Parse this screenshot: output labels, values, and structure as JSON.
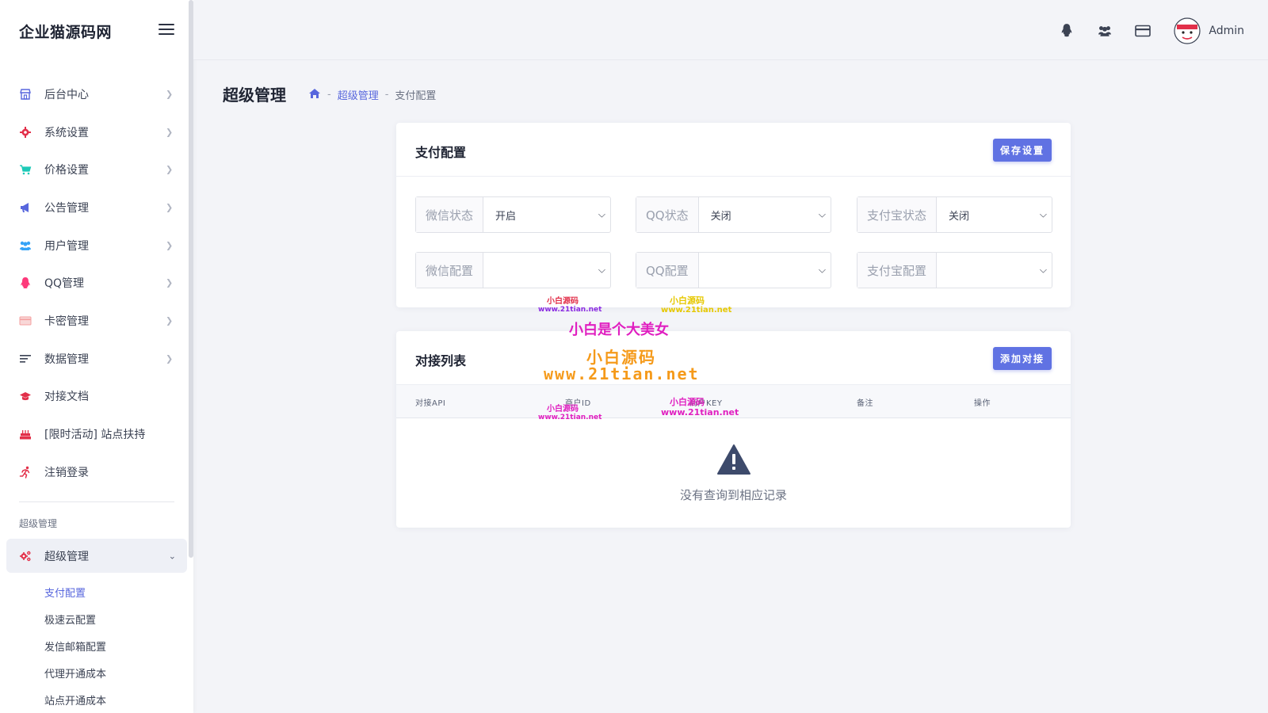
{
  "brand": {
    "name": "企业猫源码网"
  },
  "nav": [
    {
      "label": "后台中心",
      "icon": "store-icon",
      "color": "#5867dd"
    },
    {
      "label": "系统设置",
      "icon": "gear-icon",
      "color": "#e2304a"
    },
    {
      "label": "价格设置",
      "icon": "cart-icon",
      "color": "#1dc9b7"
    },
    {
      "label": "公告管理",
      "icon": "megaphone-icon",
      "color": "#5867dd"
    },
    {
      "label": "用户管理",
      "icon": "users-icon",
      "color": "#36a3f7"
    },
    {
      "label": "QQ管理",
      "icon": "qq-icon",
      "color": "#fd397a"
    },
    {
      "label": "卡密管理",
      "icon": "card-icon",
      "color": "#f5a0a0"
    },
    {
      "label": "数据管理",
      "icon": "bars-icon",
      "color": "#3b4253"
    },
    {
      "label": "对接文档",
      "icon": "graduation-cap-icon",
      "color": "#e2304a"
    },
    {
      "label": "[限时活动] 站点扶持",
      "icon": "cake-icon",
      "color": "#e2304a"
    },
    {
      "label": "注销登录",
      "icon": "running-icon",
      "color": "#e2304a"
    }
  ],
  "section_title": "超级管理",
  "active_menu": {
    "label": "超级管理",
    "icon": "cogs-icon"
  },
  "sub_menu": [
    "支付配置",
    "极速云配置",
    "发信邮箱配置",
    "代理开通成本",
    "站点开通成本"
  ],
  "header": {
    "user": "Admin"
  },
  "page": {
    "title": "超级管理",
    "breadcrumb": [
      "超级管理",
      "支付配置"
    ]
  },
  "payment_card": {
    "title": "支付配置",
    "save_button": "保存设置",
    "fields": [
      {
        "label": "微信状态",
        "value": "开启"
      },
      {
        "label": "QQ状态",
        "value": "关闭"
      },
      {
        "label": "支付宝状态",
        "value": "关闭"
      },
      {
        "label": "微信配置",
        "value": ""
      },
      {
        "label": "QQ配置",
        "value": ""
      },
      {
        "label": "支付宝配置",
        "value": ""
      }
    ]
  },
  "api_card": {
    "title": "对接列表",
    "add_button": "添加对接",
    "columns": [
      "对接API",
      "商户ID",
      "商户KEY",
      "备注",
      "操作"
    ],
    "empty_text": "没有查询到相应记录"
  },
  "watermarks": {
    "a1": "小白源码",
    "a2": "www.21tian.net",
    "b1": "小白源码",
    "b2": "www.21tian.net",
    "c": "小白是个大美女",
    "d1": "小白源码",
    "d2": "www.21tian.net",
    "e1": "小白源码",
    "e2": "www.21tian.net",
    "f1": "小白源码",
    "f2": "www.21tian.net"
  },
  "colors": {
    "accent": "#5867dd",
    "button": "#6072e3",
    "background": "#f3f4f8"
  }
}
